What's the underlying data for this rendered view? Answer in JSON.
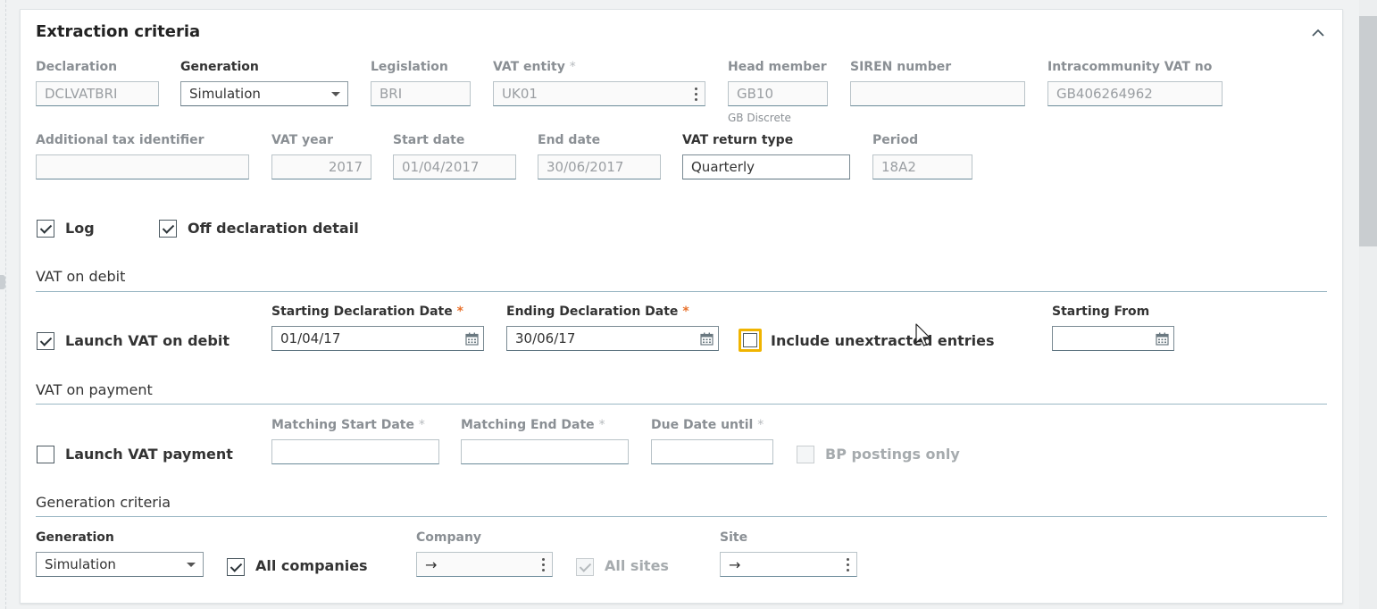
{
  "panel": {
    "title": "Extraction criteria"
  },
  "header_fields": {
    "declaration": {
      "label": "Declaration",
      "value": "DCLVATBRI"
    },
    "generation": {
      "label": "Generation",
      "value": "Simulation"
    },
    "legislation": {
      "label": "Legislation",
      "value": "BRI"
    },
    "vat_entity": {
      "label": "VAT entity",
      "value": "UK01",
      "required": "*"
    },
    "head_member": {
      "label": "Head member",
      "value": "GB10",
      "description": "GB Discrete"
    },
    "siren_number": {
      "label": "SIREN number",
      "value": ""
    },
    "intracommunity_vat_no": {
      "label": "Intracommunity VAT no",
      "value": "GB406264962"
    },
    "additional_tax_identifier": {
      "label": "Additional tax identifier",
      "value": ""
    },
    "vat_year": {
      "label": "VAT year",
      "value": "2017"
    },
    "start_date": {
      "label": "Start date",
      "value": "01/04/2017"
    },
    "end_date": {
      "label": "End date",
      "value": "30/06/2017"
    },
    "vat_return_type": {
      "label": "VAT return type",
      "value": "Quarterly"
    },
    "period": {
      "label": "Period",
      "value": "18A2"
    }
  },
  "options": {
    "log": {
      "label": "Log",
      "checked": true
    },
    "off_declaration_detail": {
      "label": "Off declaration detail",
      "checked": true
    }
  },
  "vat_on_debit": {
    "section_title": "VAT on debit",
    "launch": {
      "label": "Launch VAT on debit",
      "checked": true
    },
    "starting_declaration_date": {
      "label": "Starting Declaration Date",
      "required": "*",
      "value": "01/04/17"
    },
    "ending_declaration_date": {
      "label": "Ending Declaration Date",
      "required": "*",
      "value": "30/06/17"
    },
    "include_unextracted_entries": {
      "label": "Include unextracted entries",
      "checked": false
    },
    "starting_from": {
      "label": "Starting From",
      "value": ""
    }
  },
  "vat_on_payment": {
    "section_title": "VAT on payment",
    "launch": {
      "label": "Launch VAT payment",
      "checked": false
    },
    "matching_start_date": {
      "label": "Matching Start Date",
      "required": "*",
      "value": ""
    },
    "matching_end_date": {
      "label": "Matching End Date",
      "required": "*",
      "value": ""
    },
    "due_date_until": {
      "label": "Due Date until",
      "required": "*",
      "value": ""
    },
    "bp_postings_only": {
      "label": "BP postings only",
      "checked": false
    }
  },
  "generation_criteria": {
    "section_title": "Generation criteria",
    "generation": {
      "label": "Generation",
      "value": "Simulation"
    },
    "all_companies": {
      "label": "All companies",
      "checked": true
    },
    "company": {
      "label": "Company",
      "value": "→"
    },
    "all_sites": {
      "label": "All sites",
      "checked": true
    },
    "site": {
      "label": "Site",
      "value": "→"
    }
  },
  "colors": {
    "accent_rule": "#9ab7c4",
    "required_marker": "#e8702a",
    "focus_ring": "#f0b400"
  }
}
